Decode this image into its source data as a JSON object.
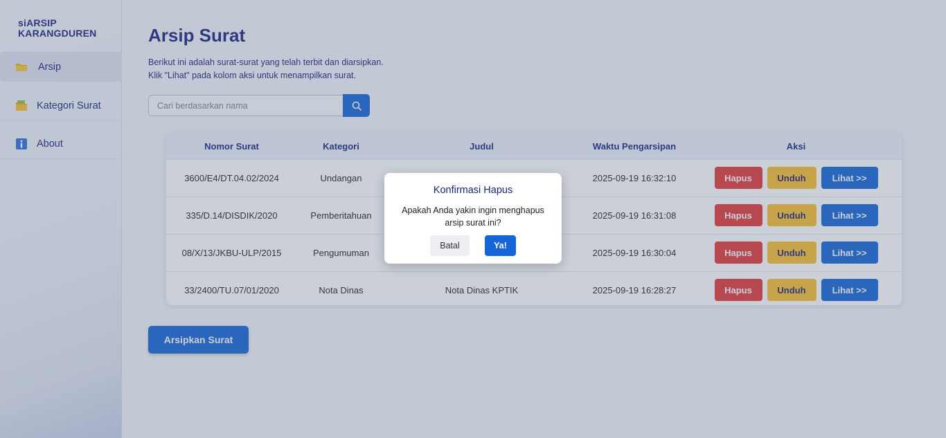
{
  "sidebar": {
    "brand_line1": "siARSIP",
    "brand_line2": "KARANGDUREN",
    "items": [
      {
        "label": "Arsip",
        "icon": "folder-icon"
      },
      {
        "label": "Kategori Surat",
        "icon": "folder-category-icon"
      },
      {
        "label": "About",
        "icon": "info-icon"
      }
    ]
  },
  "main": {
    "title": "Arsip Surat",
    "desc_line1": "Berikut ini adalah surat-surat yang telah terbit dan diarsipkan.",
    "desc_line2": "Klik \"Lihat\" pada kolom aksi untuk menampilkan surat.",
    "search": {
      "placeholder": "Cari berdasarkan nama",
      "value": ""
    },
    "archive_button": "Arsipkan Surat"
  },
  "table": {
    "headers": [
      "Nomor Surat",
      "Kategori",
      "Judul",
      "Waktu Pengarsipan",
      "Aksi"
    ],
    "rows": [
      {
        "nomor": "3600/E4/DT.04.02/2024",
        "kategori": "Undangan",
        "judul": "",
        "waktu": "2025-09-19 16:32:10"
      },
      {
        "nomor": "335/D.14/DISDIK/2020",
        "kategori": "Pemberitahuan",
        "judul": "",
        "waktu": "2025-09-19 16:31:08"
      },
      {
        "nomor": "08/X/13/JKBU-ULP/2015",
        "kategori": "Pengumuman",
        "judul": "",
        "waktu": "2025-09-19 16:30:04"
      },
      {
        "nomor": "33/2400/TU.07/01/2020",
        "kategori": "Nota Dinas",
        "judul": "Nota Dinas KPTIK",
        "waktu": "2025-09-19 16:28:27"
      }
    ],
    "actions": {
      "delete": "Hapus",
      "download": "Unduh",
      "view": "Lihat >>"
    }
  },
  "modal": {
    "title": "Konfirmasi Hapus",
    "body_line1": "Apakah Anda yakin ingin menghapus",
    "body_line2": "arsip surat ini?",
    "cancel": "Batal",
    "confirm": "Ya!"
  },
  "colors": {
    "primary": "#1565d8",
    "danger": "#e53935",
    "warning": "#fbc02d",
    "text_primary": "#1a237e"
  }
}
